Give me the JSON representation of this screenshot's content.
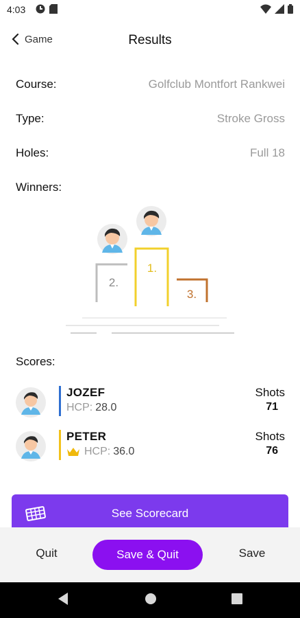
{
  "status": {
    "time": "4:03",
    "icons": [
      "circle-app-icon",
      "sd-card-icon",
      "wifi-icon",
      "signal-icon",
      "battery-icon"
    ]
  },
  "header": {
    "back_label": "Game",
    "title": "Results"
  },
  "info": {
    "course_label": "Course:",
    "course_value": "Golfclub Montfort Rankwei",
    "type_label": "Type:",
    "type_value": "Stroke Gross",
    "holes_label": "Holes:",
    "holes_value": "Full 18"
  },
  "winners": {
    "label": "Winners:",
    "places": [
      "1.",
      "2.",
      "3."
    ],
    "colors": {
      "first": "#f2d02c",
      "second": "#bdbdbd",
      "third": "#c0722e"
    }
  },
  "scores": {
    "label": "Scores:",
    "shots_label": "Shots",
    "hcp_label": "HCP:",
    "players": [
      {
        "name": "JOZEF",
        "hcp": "28.0",
        "shots": "71",
        "bar_color": "#2f6fd1",
        "crown": false
      },
      {
        "name": "PETER",
        "hcp": "36.0",
        "shots": "76",
        "bar_color": "#f2c21b",
        "crown": true
      }
    ]
  },
  "actions": {
    "scorecard_label": "See Scorecard",
    "quit_label": "Quit",
    "save_quit_label": "Save & Quit",
    "save_label": "Save"
  },
  "colors": {
    "accent": "#7c3aed",
    "accent_button": "#8b10f0",
    "muted_text": "#9a9a9a"
  }
}
